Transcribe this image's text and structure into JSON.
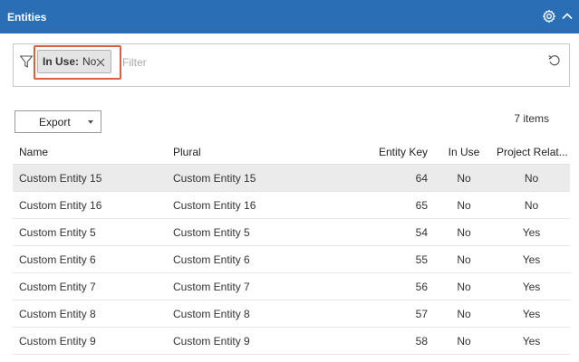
{
  "header": {
    "title": "Entities",
    "icons": [
      "gear-icon",
      "chevron-up-icon"
    ]
  },
  "filter": {
    "chip": {
      "key": "In Use:",
      "value": "No"
    },
    "placeholder": "Filter",
    "value": ""
  },
  "toolbar": {
    "export_label": "Export",
    "count_label": "7 items"
  },
  "colors": {
    "header_bg": "#2a6fb5",
    "highlight": "#d9613f",
    "selected_row": "#ebebeb"
  },
  "table": {
    "columns": [
      "Name",
      "Plural",
      "Entity Key",
      "In Use",
      "Project Relat..."
    ],
    "rows": [
      [
        "Custom Entity 15",
        "Custom Entity 15",
        "64",
        "No",
        "No"
      ],
      [
        "Custom Entity 16",
        "Custom Entity 16",
        "65",
        "No",
        "No"
      ],
      [
        "Custom Entity 5",
        "Custom Entity 5",
        "54",
        "No",
        "Yes"
      ],
      [
        "Custom Entity 6",
        "Custom Entity 6",
        "55",
        "No",
        "Yes"
      ],
      [
        "Custom Entity 7",
        "Custom Entity 7",
        "56",
        "No",
        "Yes"
      ],
      [
        "Custom Entity 8",
        "Custom Entity 8",
        "57",
        "No",
        "Yes"
      ],
      [
        "Custom Entity 9",
        "Custom Entity 9",
        "58",
        "No",
        "Yes"
      ]
    ]
  }
}
